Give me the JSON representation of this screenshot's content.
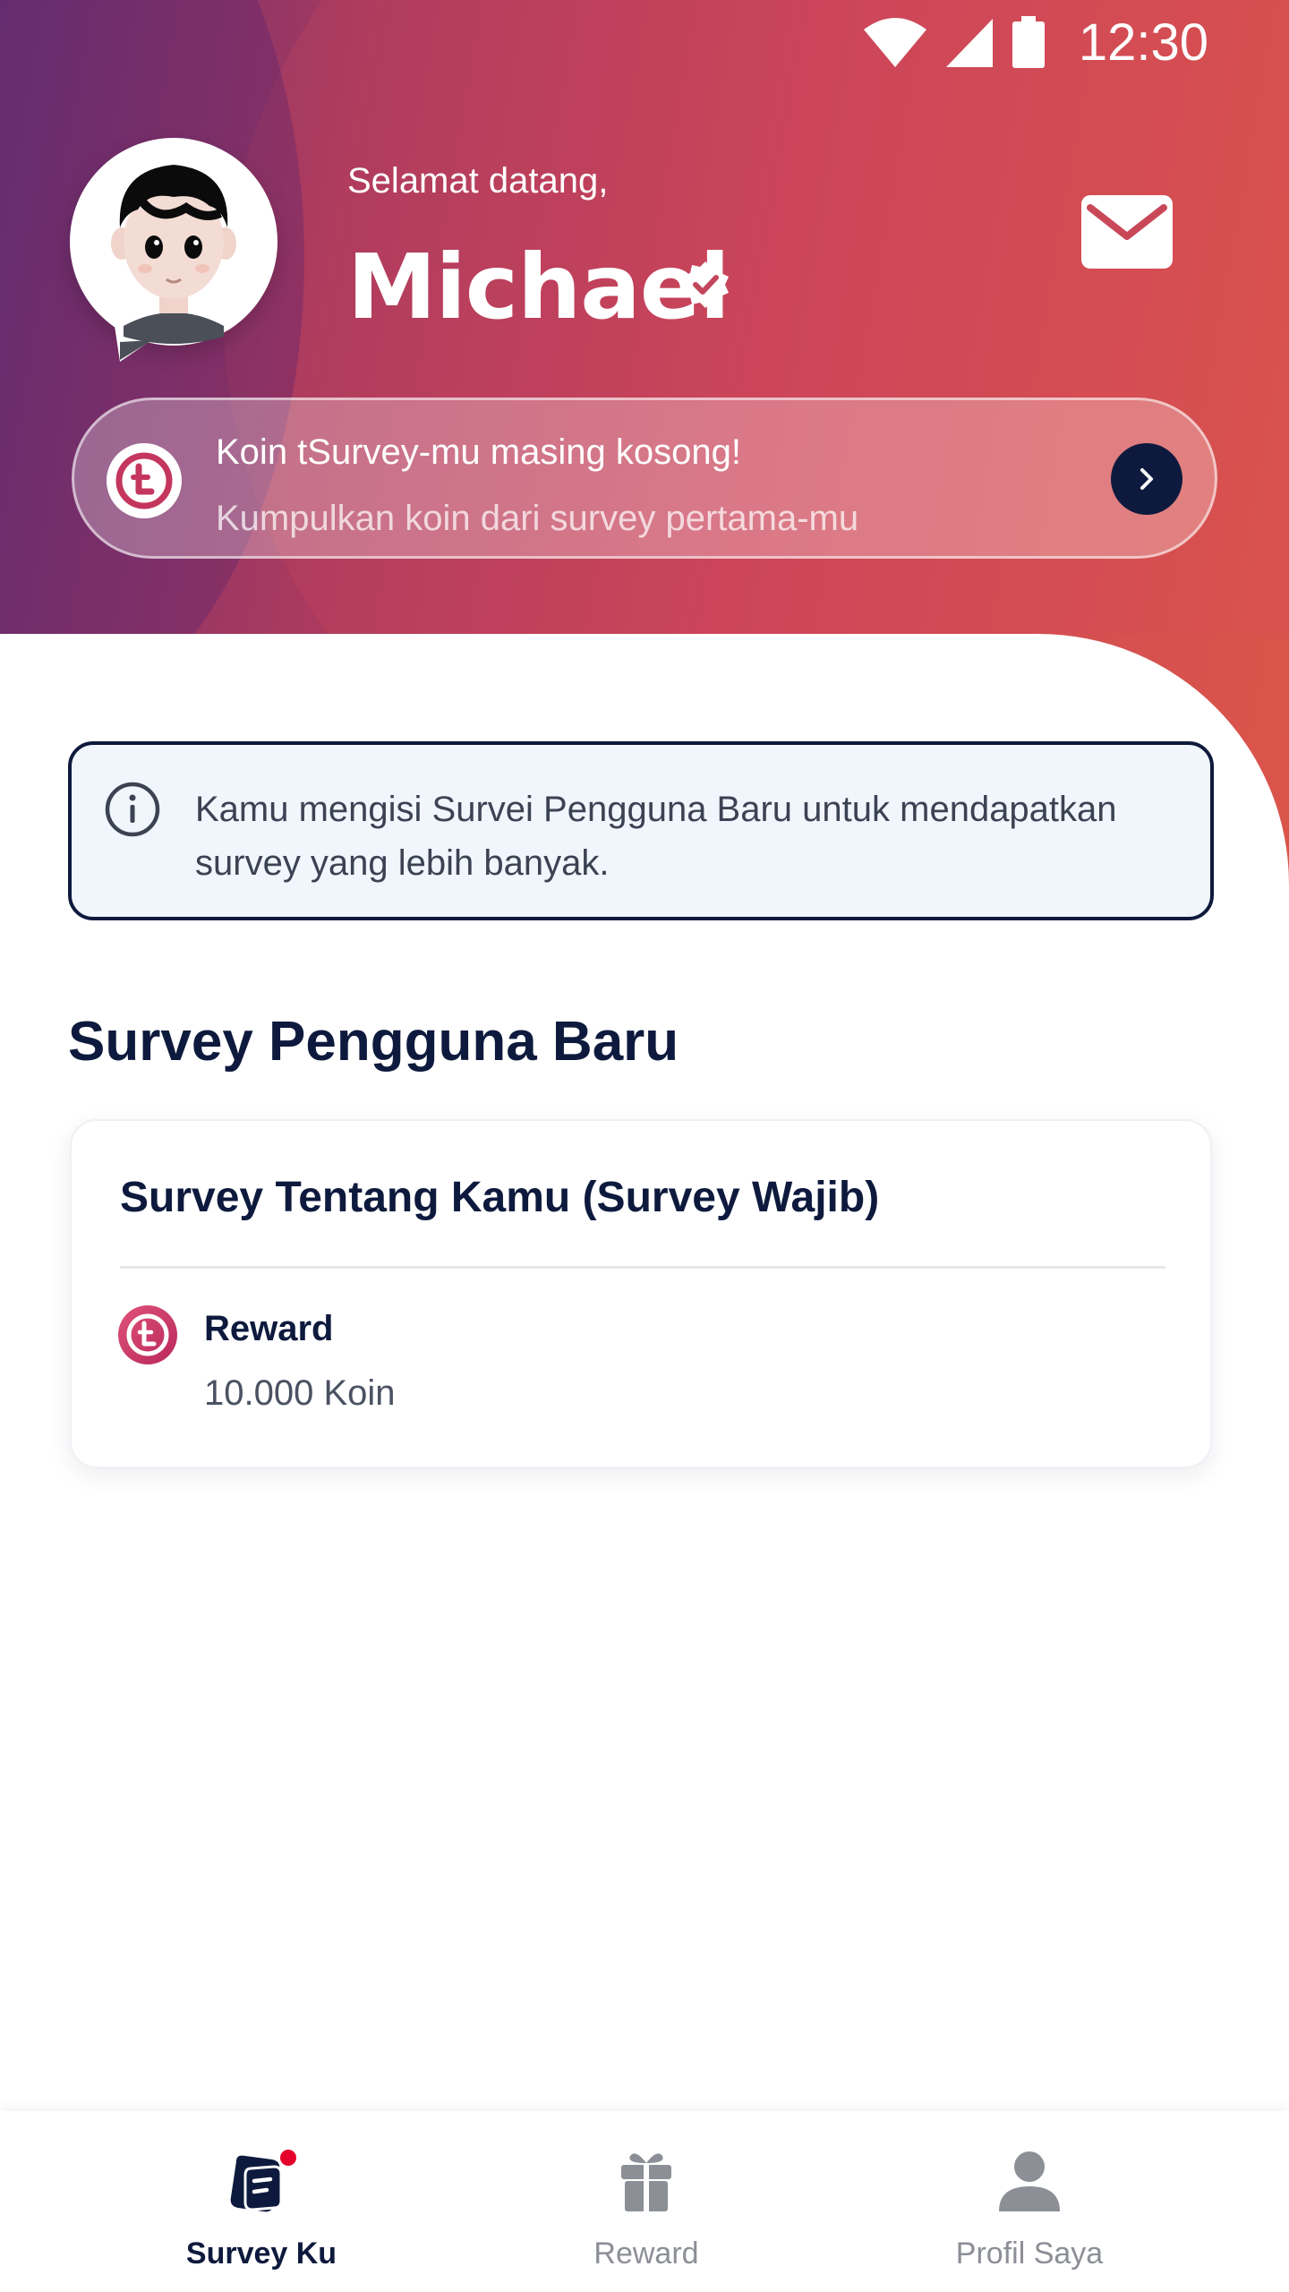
{
  "status_bar": {
    "time": "12:30"
  },
  "header": {
    "greeting": "Selamat datang,",
    "username": "Michael"
  },
  "coin_banner": {
    "line1": "Koin tSurvey-mu masing kosong!",
    "line2": "Kumpulkan koin dari survey pertama-mu"
  },
  "info_box": {
    "text": "Kamu  mengisi Survei Pengguna Baru untuk mendapatkan survey yang lebih banyak."
  },
  "section": {
    "title": "Survey Pengguna Baru"
  },
  "survey_card": {
    "title": "Survey Tentang Kamu (Survey Wajib)",
    "reward_label": "Reward",
    "reward_value": "10.000 Koin"
  },
  "bottom_nav": {
    "items": [
      {
        "label": "Survey Ku",
        "icon": "survey-icon",
        "active": true
      },
      {
        "label": "Reward",
        "icon": "gift-icon",
        "active": false
      },
      {
        "label": "Profil Saya",
        "icon": "person-icon",
        "active": false
      }
    ]
  },
  "colors": {
    "primary_dark": "#0e1a3d",
    "brand_pink": "#c9445a",
    "notification_red": "#e5002b"
  }
}
